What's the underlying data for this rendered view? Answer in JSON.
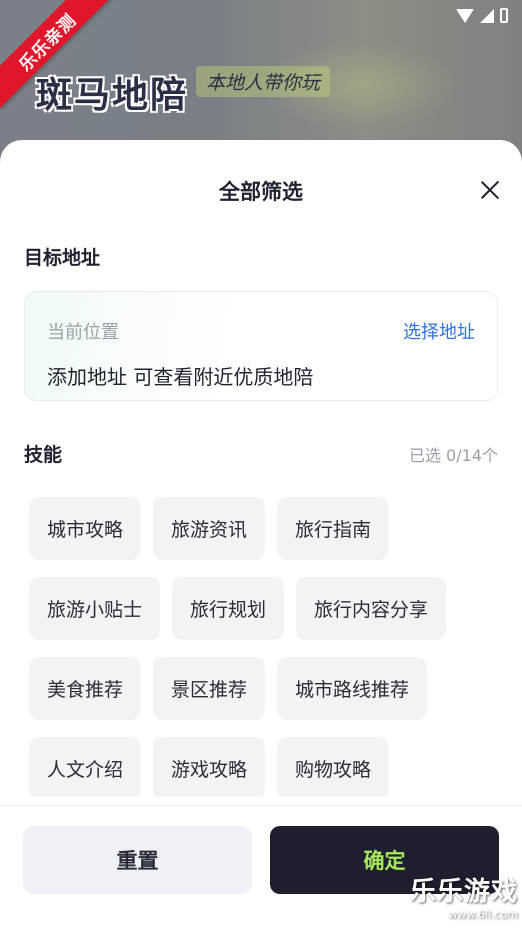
{
  "status_bar": {
    "icons": [
      "wifi-icon",
      "signal-icon",
      "battery-icon"
    ]
  },
  "background_app": {
    "ribbon": "乐乐亲测",
    "logo": "斑马地陪",
    "slogan": "本地人带你玩"
  },
  "sheet": {
    "title": "全部筛选",
    "close_icon": "close-icon",
    "address": {
      "section_title": "目标地址",
      "label": "当前位置",
      "select_link": "选择地址",
      "hint": "添加地址 可查看附近优质地陪"
    },
    "skills": {
      "section_title": "技能",
      "count": "已选 0/14个",
      "rows": [
        [
          "城市攻略",
          "旅游资讯",
          "旅行指南"
        ],
        [
          "旅游小贴士",
          "旅行规划",
          "旅行内容分享"
        ],
        [
          "美食推荐",
          "景区推荐",
          "城市路线推荐"
        ],
        [
          "人文介绍",
          "游戏攻略",
          "购物攻略"
        ]
      ]
    },
    "footer": {
      "reset_label": "重置",
      "confirm_label": "确定"
    }
  },
  "watermark": {
    "main": "乐乐游戏",
    "url": "www.6ll.com"
  },
  "colors": {
    "accent_link": "#2f73e0",
    "confirm_bg": "#1d1f2e",
    "confirm_text": "#a8e65c",
    "ribbon": "#e0162b"
  }
}
